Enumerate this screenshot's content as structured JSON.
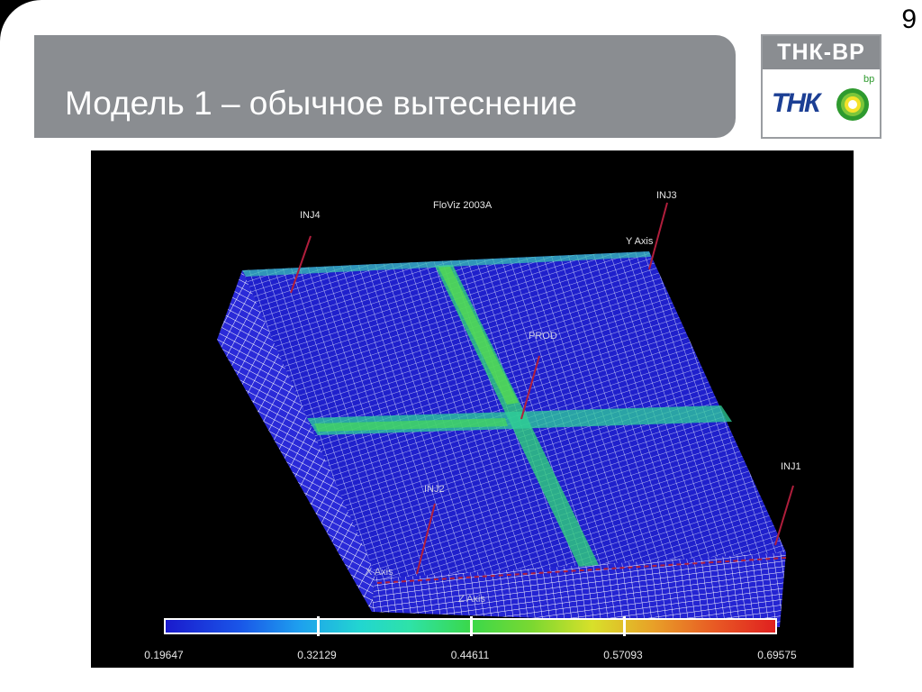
{
  "slide": {
    "page_number": "9",
    "title": "Модель 1 – обычное вытеснение"
  },
  "logo": {
    "brand": "ТНК-ВР",
    "tnk": "ТНК",
    "bp": "bp"
  },
  "viz": {
    "app_title": "FloViz 2003A",
    "y_axis_label": "Y Axis",
    "wells": [
      "INJ4",
      "INJ3",
      "INJ1",
      "PROD",
      "INJ2"
    ],
    "axis_labels": [
      "X Axis",
      "Z Axis"
    ],
    "colorbar_ticks": [
      "0.19647",
      "0.32129",
      "0.44611",
      "0.57093",
      "0.69575"
    ],
    "colors": {
      "mesh_blue": "#1e1ecf",
      "mesh_line": "#e8ecff",
      "front_green": "#2ecf6a",
      "well_line": "#a01830"
    }
  }
}
